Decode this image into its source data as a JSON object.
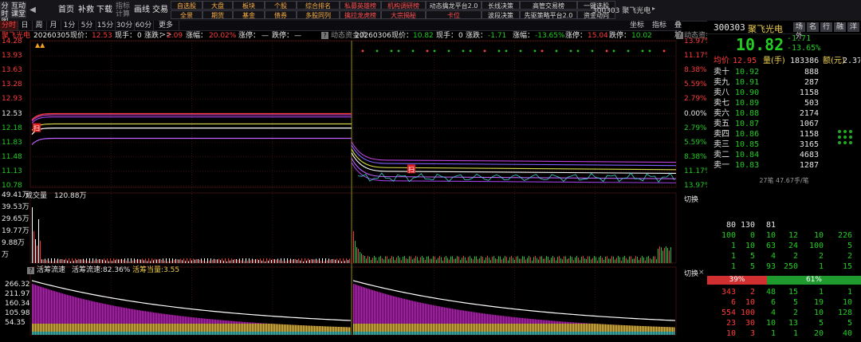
{
  "toolbar": {
    "left_buttons": [
      {
        "label": "分时\n图"
      },
      {
        "label": "互动\n课堂"
      }
    ],
    "nav_buttons": [
      "首页",
      "补救",
      "下载"
    ],
    "indicator_button": "指标\n计算",
    "line_button": "画线",
    "trade_button": "交易",
    "row1_cells": [
      "自选股",
      "大盘",
      "板块",
      "个股",
      "综合排名",
      "私募英雄榜",
      "机构调研榜",
      "动态擒龙平台2.0",
      "长线决策",
      "高管交易榜",
      "一键选股"
    ],
    "row2_cells": [
      "全景",
      "期货",
      "基金",
      "债券",
      "多股同列",
      "擒拉龙虎榜",
      "大宗揭秘",
      "卡位",
      "波段决策",
      "先驱策略平台2.0",
      "资金动向"
    ],
    "code_title": "300303  聚飞光电"
  },
  "periodbar": {
    "tabs": [
      "分时",
      "日",
      "周",
      "月",
      "1分",
      "5分",
      "15分",
      "30分",
      "60分",
      "更多>>"
    ],
    "right_buttons": [
      "坐标",
      "指标",
      "叠加"
    ]
  },
  "day1": {
    "header_name": "聚飞光电",
    "date": "20260305",
    "price_label": "现价：",
    "price": "12.53",
    "hand_label": "现手：",
    "hand": "0",
    "change_label": "涨跌：",
    "change": "2.09",
    "pct_label": "涨幅：",
    "pct": "20.02%",
    "limit_up_label": "涨停：",
    "limit_up": "—",
    "limit_down_label": "跌停：",
    "limit_down": "—"
  },
  "day2": {
    "date": "20260306",
    "price_label": "现价：",
    "price": "10.82",
    "hand_label": "现手：",
    "hand": "0",
    "change_label": "涨跌：",
    "change": "-1.71",
    "pct_label": "涨幅：",
    "pct": "-13.65%",
    "limit_up_label": "涨停：",
    "limit_up": "15.04",
    "limit_down_label": "跌停：",
    "limit_down": "10.02",
    "flow_label": "动态资金流"
  },
  "price_axis_left": [
    "14.28",
    "13.93",
    "13.63",
    "13.28",
    "12.93",
    "12.53",
    "12.18",
    "11.83",
    "11.48",
    "11.13",
    "10.78"
  ],
  "price_axis_right": [
    "13.97%",
    "11.17%",
    "8.38%",
    "5.59%",
    "2.79%",
    "0.00%",
    "2.79%",
    "5.59%",
    "8.38%",
    "11.17%",
    "13.97%"
  ],
  "volume": {
    "title_label": "成交量",
    "title_value": "120.88万",
    "axis": [
      "49.41万",
      "39.53万",
      "29.65万",
      "19.77万",
      "9.88万",
      "万"
    ],
    "switch": "切换"
  },
  "active": {
    "title": "活筹流速",
    "sub1": "活筹流速:82.36%",
    "sub2": "活筹当量:3.55",
    "axis": [
      "266.32",
      "211.97",
      "160.34",
      "105.98",
      "54.35"
    ],
    "switch": "切换"
  },
  "chart_data": {
    "type": "line",
    "title": "聚飞光电",
    "xlabel": "",
    "ylabel": "",
    "ylim": [
      10.78,
      14.28
    ],
    "x": [
      "20260305",
      "20260306"
    ],
    "series": [
      {
        "values": [
          12.53,
          10.82
        ]
      }
    ]
  },
  "rpanel": {
    "code": "300303",
    "name": "聚飞光电",
    "tabs": [
      "场外",
      "名",
      "行",
      "融",
      "洋"
    ],
    "big_price": "10.82",
    "change": "-1.71",
    "pct": "-13.65%",
    "avg_label": "均价",
    "avg_value": "12.95",
    "vol_label": "量(手)",
    "vol_value": "183386",
    "amt_label": "额(元)",
    "amt_value": "2.37亿",
    "asks": [
      {
        "label": "卖十",
        "price": "10.92",
        "vol": "888"
      },
      {
        "label": "卖九",
        "price": "10.91",
        "vol": "287"
      },
      {
        "label": "卖八",
        "price": "10.90",
        "vol": "1158"
      },
      {
        "label": "卖七",
        "price": "10.89",
        "vol": "503"
      },
      {
        "label": "卖六",
        "price": "10.88",
        "vol": "2174"
      },
      {
        "label": "卖五",
        "price": "10.87",
        "vol": "1067"
      },
      {
        "label": "卖四",
        "price": "10.86",
        "vol": "1158"
      },
      {
        "label": "卖三",
        "price": "10.85",
        "vol": "3165"
      },
      {
        "label": "卖二",
        "price": "10.84",
        "vol": "4683"
      },
      {
        "label": "卖一",
        "price": "10.83",
        "vol": "1287"
      }
    ],
    "trade_summary": "27笔  47.67手/笔",
    "tick_rows": [
      [
        "80",
        "130",
        "81",
        "",
        "",
        ""
      ],
      [
        "100",
        "0",
        "10",
        "12",
        "10",
        "226"
      ],
      [
        "1",
        "10",
        "63",
        "24",
        "100",
        "5"
      ],
      [
        "1",
        "5",
        "4",
        "2",
        "2",
        "2"
      ],
      [
        "1",
        "5",
        "93",
        "250",
        "1",
        "15"
      ]
    ],
    "ratio_left": "39%",
    "ratio_right": "61%",
    "bottom_rows": [
      [
        "343",
        "2",
        "48",
        "15",
        "1",
        "1"
      ],
      [
        "6",
        "10",
        "6",
        "5",
        "19",
        "10"
      ],
      [
        "554",
        "100",
        "4",
        "2",
        "10",
        "128"
      ],
      [
        "23",
        "30",
        "10",
        "13",
        "5",
        "5"
      ],
      [
        "10",
        "3",
        "1",
        "1",
        "20",
        "40"
      ]
    ]
  }
}
